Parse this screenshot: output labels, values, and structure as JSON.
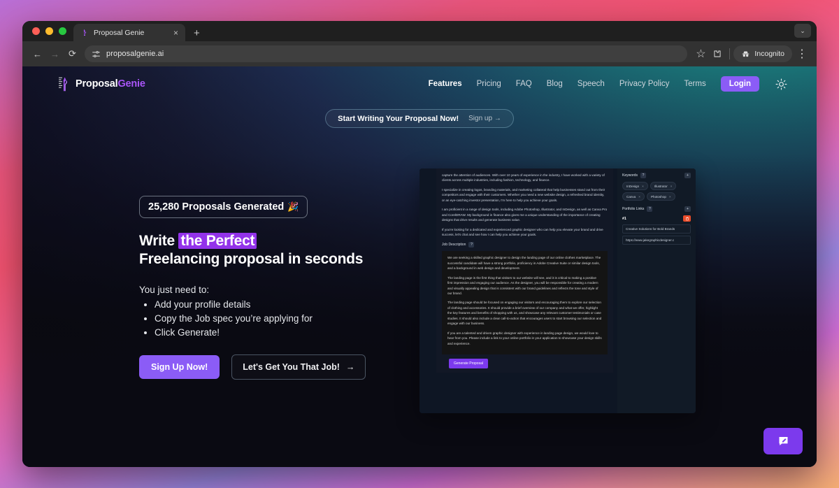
{
  "browser": {
    "tab": {
      "title": "Proposal Genie",
      "favicon": "genie-lamp-icon",
      "close": "×"
    },
    "new_tab": "+",
    "window_chevron": "⌄",
    "nav": {
      "back": "←",
      "forward": "→",
      "reload": "⟳"
    },
    "omnibox": {
      "url": "proposalgenie.ai",
      "site_settings_icon": "tune-icon"
    },
    "actions": {
      "bookmark": "☆",
      "extensions": "puzzle-icon",
      "menu": "⋮"
    },
    "incognito": {
      "label": "Incognito",
      "icon": "incognito-hat-icon"
    }
  },
  "site": {
    "logo": {
      "name_part1": "Proposal",
      "name_part2": "Genie"
    },
    "nav_links": [
      {
        "label": "Features",
        "active": true
      },
      {
        "label": "Pricing",
        "active": false
      },
      {
        "label": "FAQ",
        "active": false
      },
      {
        "label": "Blog",
        "active": false
      },
      {
        "label": "Speech",
        "active": false
      },
      {
        "label": "Privacy Policy",
        "active": false
      },
      {
        "label": "Terms",
        "active": false
      }
    ],
    "login_label": "Login",
    "theme_toggle": "sun-icon",
    "promo": {
      "main": "Start Writing Your Proposal Now!",
      "sub": "Sign up →"
    }
  },
  "hero": {
    "stat": {
      "text": "25,280 Proposals Generated",
      "emoji": "🎉"
    },
    "headline": {
      "pre": "Write ",
      "highlight": "the Perfect",
      "line2": "Freelancing proposal in seconds"
    },
    "need_title": "You just need to:",
    "need_items": [
      "Add your profile details",
      "Copy the Job spec you’re applying for",
      "Click Generate!"
    ],
    "primary_cta": "Sign Up Now!",
    "secondary_cta": "Let's Get You That Job!",
    "secondary_cta_arrow": "→"
  },
  "app_preview": {
    "proposal_paragraphs": [
      "capture the attention of audiences. With over 10 years of experience in the industry, I have worked with a variety of clients across multiple industries, including fashion, technology, and finance.",
      "I specialize in creating logos, branding materials, and marketing collateral that help businesses stand out from their competitors and engage with their customers. Whether you need a new website design, a refreshed brand identity, or an eye-catching investor presentation, I'm here to help you achieve your goals.",
      "I am proficient in a range of design tools, including Adobe Photoshop, Illustrator, and InDesign, as well as Canva Pro and CorelDRAW. My background in finance also gives me a unique understanding of the importance of creating designs that drive results and generate business value.",
      "If you're looking for a dedicated and experienced graphic designer who can help you elevate your brand and drive success, let's chat and see how I can help you achieve your goals."
    ],
    "job_description_label": "Job Description",
    "job_description_paragraphs": [
      "We are seeking a skilled graphic designer to design the landing page of our online clothes marketplace. The successful candidate will have a strong portfolio, proficiency in Adobe Creative Suite or similar design tools, and a background in web design and development.",
      "The landing page is the first thing that visitors to our website will see, and it is critical to making a positive first impression and engaging our audience. As the designer, you will be responsible for creating a modern and visually appealing design that is consistent with our brand guidelines and reflects the tone and style of our brand.",
      "The landing page should be focused on engaging our visitors and encouraging them to explore our selection of clothing and accessories. It should provide a brief overview of our company and what we offer, highlight the key features and benefits of shopping with us, and showcase any relevant customer testimonials or case studies. It should also include a clear call-to-action that encourages users to start browsing our selection and engage with our business.",
      "If you are a talented and driven graphic designer with experience in landing page design, we would love to hear from you. Please include a link to your online portfolio in your application to showcase your design skills and experience."
    ],
    "generate_button": "Generate Proposal",
    "keywords_panel": {
      "title": "Keywords",
      "help": "?",
      "add": "+",
      "chips": [
        "InDesign",
        "Illustrator",
        "Canva",
        "Photoshop"
      ],
      "chip_remove": "×"
    },
    "portfolio_panel": {
      "title": "Portfolio Links",
      "help": "?",
      "add": "+",
      "entry_number": "#1",
      "delete_icon": "trash-icon",
      "title_value": "Creative Solutions for Bold Brands",
      "url_value": "https://www.jakegraphicdesigner.c"
    }
  },
  "chat_widget": {
    "icon": "feedback-pen-icon"
  },
  "colors": {
    "accent_purple": "#8b5cf6",
    "highlight_purple": "#9333ea",
    "danger_red": "#ea4c2a",
    "logo_purple": "#a855f7"
  }
}
